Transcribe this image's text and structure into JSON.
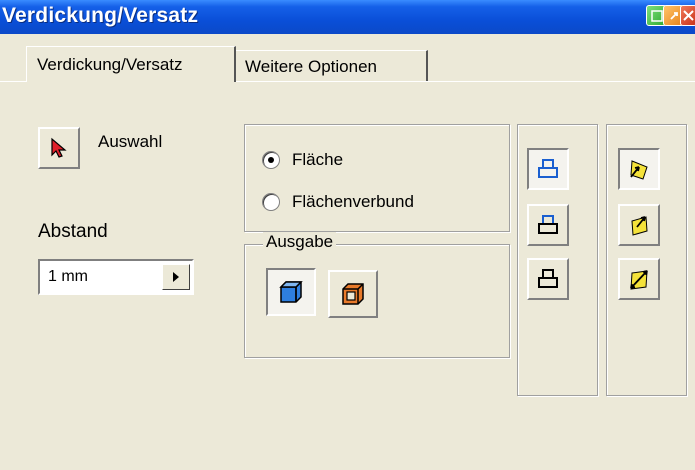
{
  "window": {
    "title": "Verdickung/Versatz"
  },
  "tabs": [
    {
      "label": "Verdickung/Versatz",
      "active": true
    },
    {
      "label": "Weitere Optionen",
      "active": false
    }
  ],
  "selection": {
    "label": "Auswahl",
    "icon": "arrow-cursor-icon"
  },
  "distance": {
    "label": "Abstand",
    "value": "1 mm"
  },
  "mode": {
    "options": [
      {
        "label": "Fläche",
        "checked": true
      },
      {
        "label": "Flächenverbund",
        "checked": false
      }
    ]
  },
  "output": {
    "label": "Ausgabe",
    "buttons": [
      {
        "icon": "solid-cube-icon",
        "pressed": true
      },
      {
        "icon": "hollow-cube-icon",
        "pressed": false
      }
    ]
  },
  "colors": {
    "titlebar": "#0b4fd8",
    "panel": "#ece9d8",
    "accent_blue": "#2e7fe0",
    "accent_yellow": "#f4e23a"
  }
}
